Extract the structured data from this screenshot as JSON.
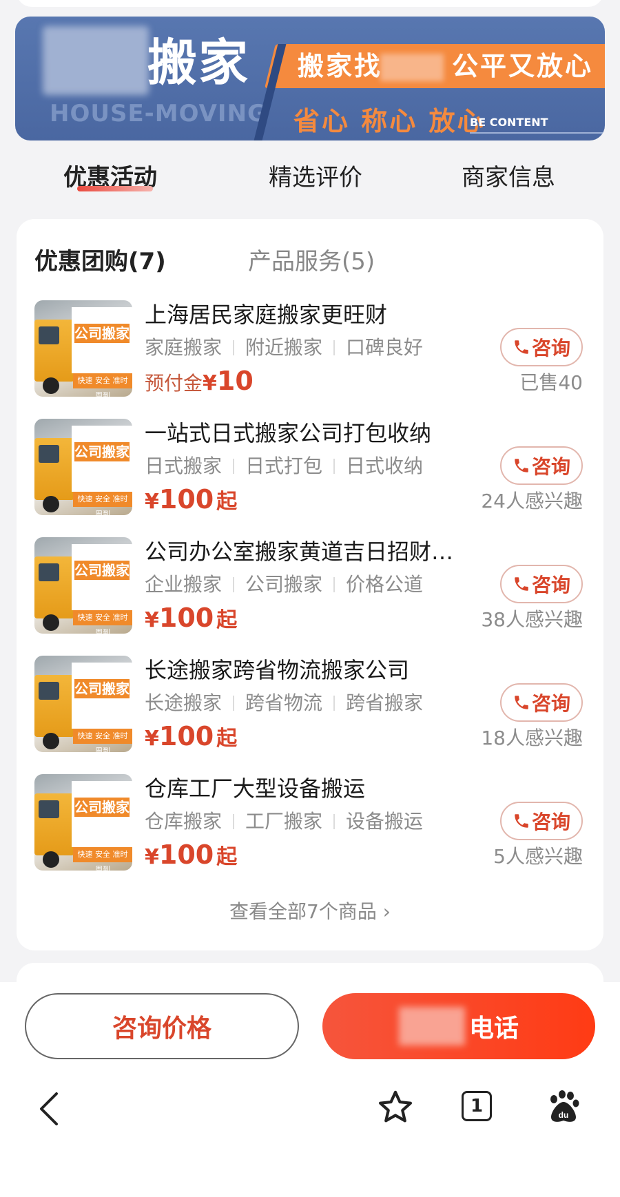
{
  "banner": {
    "title": "搬家",
    "subtitle_en": "HOUSE-MOVING",
    "slogan_line1_a": "搬家找",
    "slogan_line1_b": "公平又放心",
    "slogan_line2": "省心 称心 放心",
    "slogan_en": "BE CONTENT"
  },
  "tabs": [
    {
      "label": "优惠活动",
      "active": true
    },
    {
      "label": "精选评价",
      "active": false
    },
    {
      "label": "商家信息",
      "active": false
    }
  ],
  "subtabs": {
    "group_buy": "优惠团购(7)",
    "services": "产品服务(5)"
  },
  "consult_label": "咨询",
  "products": [
    {
      "title": "上海居民家庭搬家更旺财",
      "tags": [
        "家庭搬家",
        "附近搬家",
        "口碑良好"
      ],
      "price_label": "预付金",
      "currency": "¥",
      "price": "10",
      "price_suffix": "",
      "meta": "已售40"
    },
    {
      "title": "一站式日式搬家公司打包收纳",
      "tags": [
        "日式搬家",
        "日式打包",
        "日式收纳"
      ],
      "price_label": "",
      "currency": "¥",
      "price": "100",
      "price_suffix": "起",
      "meta": "24人感兴趣"
    },
    {
      "title": "公司办公室搬家黄道吉日招财…",
      "tags": [
        "企业搬家",
        "公司搬家",
        "价格公道"
      ],
      "price_label": "",
      "currency": "¥",
      "price": "100",
      "price_suffix": "起",
      "meta": "38人感兴趣"
    },
    {
      "title": "长途搬家跨省物流搬家公司",
      "tags": [
        "长途搬家",
        "跨省物流",
        "跨省搬家"
      ],
      "price_label": "",
      "currency": "¥",
      "price": "100",
      "price_suffix": "起",
      "meta": "18人感兴趣"
    },
    {
      "title": "仓库工厂大型设备搬运",
      "tags": [
        "仓库搬家",
        "工厂搬家",
        "设备搬运"
      ],
      "price_label": "",
      "currency": "¥",
      "price": "100",
      "price_suffix": "起",
      "meta": "5人感兴趣"
    }
  ],
  "thumb_text": {
    "main": "公司搬家",
    "strip": "快速 安全 准时 周到"
  },
  "view_all": "查看全部7个商品 ›",
  "actions": {
    "consult_price": "咨询价格",
    "phone": "电话"
  },
  "browser": {
    "tab_count": "1"
  },
  "colors": {
    "accent_red": "#d9462b",
    "banner_blue": "#4a67a1",
    "banner_orange": "#f58a3e",
    "phone_button": "#ff3b14"
  },
  "icons": [
    "phone-icon",
    "back-icon",
    "star-icon",
    "tabs-icon",
    "baidu-paw-icon",
    "chevron-right-icon"
  ]
}
